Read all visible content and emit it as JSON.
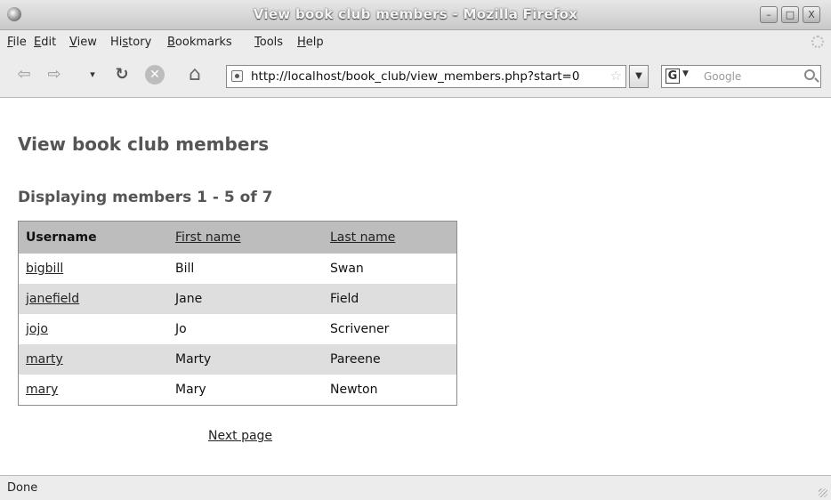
{
  "window": {
    "title": "View book club members - Mozilla Firefox",
    "controls": {
      "minimize": "–",
      "maximize": "□",
      "close": "X"
    }
  },
  "menu": [
    {
      "pre": "",
      "key": "F",
      "post": "ile"
    },
    {
      "pre": "",
      "key": "E",
      "post": "dit"
    },
    {
      "pre": "",
      "key": "V",
      "post": "iew"
    },
    {
      "pre": "Hi",
      "key": "s",
      "post": "tory"
    },
    {
      "pre": "",
      "key": "B",
      "post": "ookmarks"
    },
    {
      "pre": "",
      "key": "T",
      "post": "ools"
    },
    {
      "pre": "",
      "key": "H",
      "post": "elp"
    }
  ],
  "toolbar": {
    "back_glyph": "⇦",
    "forward_glyph": "⇨",
    "history_glyph": "▾",
    "reload_glyph": "↻",
    "stop_glyph": "✕",
    "home_glyph": "⌂",
    "url": "http://localhost/book_club/view_members.php?start=0",
    "star_glyph": "☆",
    "dropdown_glyph": "▼",
    "search_engine": "G",
    "search_engine_arrow": "▼",
    "search_placeholder": "Google"
  },
  "page": {
    "title": "View book club members",
    "subtitle": "Displaying members 1 - 5 of 7",
    "table": {
      "headers": [
        "Username",
        "First name",
        "Last name"
      ],
      "rows": [
        [
          "bigbill",
          "Bill",
          "Swan"
        ],
        [
          "janefield",
          "Jane",
          "Field"
        ],
        [
          "jojo",
          "Jo",
          "Scrivener"
        ],
        [
          "marty",
          "Marty",
          "Pareene"
        ],
        [
          "mary",
          "Mary",
          "Newton"
        ]
      ]
    },
    "next_link": "Next page"
  },
  "status": {
    "text": "Done"
  },
  "colors": {
    "header_bg": "#bdbdbd",
    "alt_row_bg": "#dedede",
    "heading_text": "#555555"
  }
}
